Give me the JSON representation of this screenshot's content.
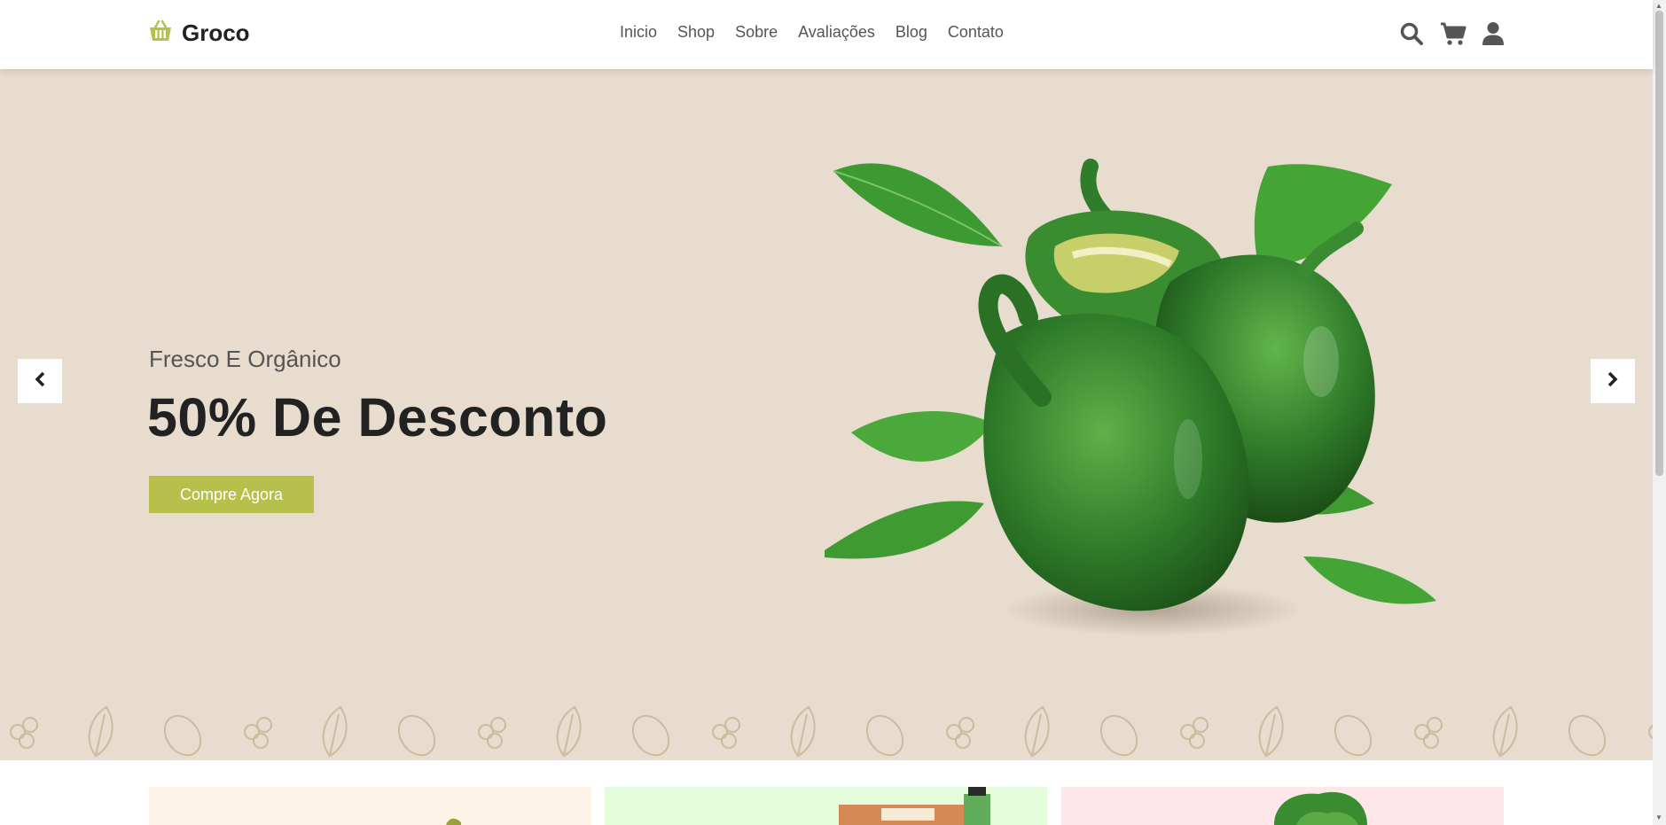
{
  "brand": {
    "name": "Groco",
    "accent": "#b6c04a"
  },
  "nav": {
    "items": [
      "Inicio",
      "Shop",
      "Sobre",
      "Avaliações",
      "Blog",
      "Contato"
    ]
  },
  "header_icons": [
    "search-icon",
    "cart-icon",
    "user-icon"
  ],
  "hero": {
    "subtitle": "Fresco E Orgânico",
    "headline": "50% De Desconto",
    "cta": "Compre Agora",
    "background": "#e7dccd"
  },
  "cards": [
    {
      "background": "#fdf3e7"
    },
    {
      "background": "#e3fcd9"
    },
    {
      "background": "#fde7ea"
    }
  ]
}
